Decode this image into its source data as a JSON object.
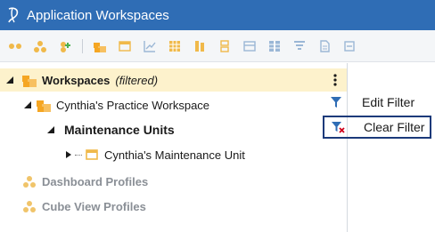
{
  "app": {
    "title": "Application Workspaces"
  },
  "toolbar": {
    "icons": [
      "group-icon",
      "group-split-icon",
      "add-group-icon",
      "workspace-icon",
      "dashboard-icon",
      "chart-icon",
      "grid-icon",
      "cube-view-icon",
      "component-icon",
      "table-icon",
      "filter-tree-icon",
      "document-icon",
      "more-icon"
    ]
  },
  "tree": {
    "workspaces_label": "Workspaces",
    "workspaces_status": "(filtered)",
    "practice_workspace_label": "Cynthia's Practice Workspace",
    "maintenance_units_label": "Maintenance Units",
    "maintenance_unit_label": "Cynthia's Maintenance Unit",
    "dashboard_profiles_label": "Dashboard Profiles",
    "cube_view_profiles_label": "Cube View Profiles"
  },
  "context_menu": {
    "edit_filter_label": "Edit Filter",
    "clear_filter_label": "Clear Filter"
  },
  "colors": {
    "titlebar": "#2f6db5",
    "selected_row": "#fdf2cc",
    "focus_border": "#1b3a7a",
    "accent_orange": "#f5a623",
    "filter_blue": "#2f6db5",
    "clear_red": "#d0021b"
  }
}
